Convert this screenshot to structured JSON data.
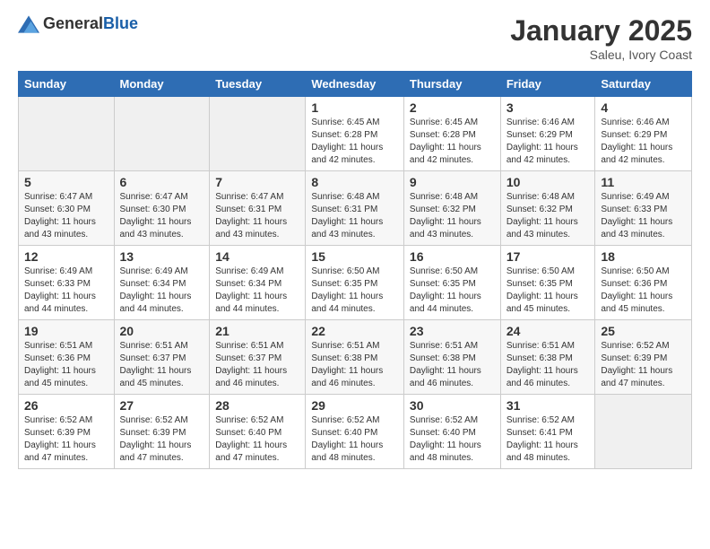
{
  "logo": {
    "general": "General",
    "blue": "Blue"
  },
  "title": {
    "month": "January 2025",
    "location": "Saleu, Ivory Coast"
  },
  "headers": [
    "Sunday",
    "Monday",
    "Tuesday",
    "Wednesday",
    "Thursday",
    "Friday",
    "Saturday"
  ],
  "weeks": [
    [
      {
        "day": "",
        "info": "",
        "empty": true
      },
      {
        "day": "",
        "info": "",
        "empty": true
      },
      {
        "day": "",
        "info": "",
        "empty": true
      },
      {
        "day": "1",
        "info": "Sunrise: 6:45 AM\nSunset: 6:28 PM\nDaylight: 11 hours\nand 42 minutes.",
        "empty": false
      },
      {
        "day": "2",
        "info": "Sunrise: 6:45 AM\nSunset: 6:28 PM\nDaylight: 11 hours\nand 42 minutes.",
        "empty": false
      },
      {
        "day": "3",
        "info": "Sunrise: 6:46 AM\nSunset: 6:29 PM\nDaylight: 11 hours\nand 42 minutes.",
        "empty": false
      },
      {
        "day": "4",
        "info": "Sunrise: 6:46 AM\nSunset: 6:29 PM\nDaylight: 11 hours\nand 42 minutes.",
        "empty": false
      }
    ],
    [
      {
        "day": "5",
        "info": "Sunrise: 6:47 AM\nSunset: 6:30 PM\nDaylight: 11 hours\nand 43 minutes.",
        "empty": false
      },
      {
        "day": "6",
        "info": "Sunrise: 6:47 AM\nSunset: 6:30 PM\nDaylight: 11 hours\nand 43 minutes.",
        "empty": false
      },
      {
        "day": "7",
        "info": "Sunrise: 6:47 AM\nSunset: 6:31 PM\nDaylight: 11 hours\nand 43 minutes.",
        "empty": false
      },
      {
        "day": "8",
        "info": "Sunrise: 6:48 AM\nSunset: 6:31 PM\nDaylight: 11 hours\nand 43 minutes.",
        "empty": false
      },
      {
        "day": "9",
        "info": "Sunrise: 6:48 AM\nSunset: 6:32 PM\nDaylight: 11 hours\nand 43 minutes.",
        "empty": false
      },
      {
        "day": "10",
        "info": "Sunrise: 6:48 AM\nSunset: 6:32 PM\nDaylight: 11 hours\nand 43 minutes.",
        "empty": false
      },
      {
        "day": "11",
        "info": "Sunrise: 6:49 AM\nSunset: 6:33 PM\nDaylight: 11 hours\nand 43 minutes.",
        "empty": false
      }
    ],
    [
      {
        "day": "12",
        "info": "Sunrise: 6:49 AM\nSunset: 6:33 PM\nDaylight: 11 hours\nand 44 minutes.",
        "empty": false
      },
      {
        "day": "13",
        "info": "Sunrise: 6:49 AM\nSunset: 6:34 PM\nDaylight: 11 hours\nand 44 minutes.",
        "empty": false
      },
      {
        "day": "14",
        "info": "Sunrise: 6:49 AM\nSunset: 6:34 PM\nDaylight: 11 hours\nand 44 minutes.",
        "empty": false
      },
      {
        "day": "15",
        "info": "Sunrise: 6:50 AM\nSunset: 6:35 PM\nDaylight: 11 hours\nand 44 minutes.",
        "empty": false
      },
      {
        "day": "16",
        "info": "Sunrise: 6:50 AM\nSunset: 6:35 PM\nDaylight: 11 hours\nand 44 minutes.",
        "empty": false
      },
      {
        "day": "17",
        "info": "Sunrise: 6:50 AM\nSunset: 6:35 PM\nDaylight: 11 hours\nand 45 minutes.",
        "empty": false
      },
      {
        "day": "18",
        "info": "Sunrise: 6:50 AM\nSunset: 6:36 PM\nDaylight: 11 hours\nand 45 minutes.",
        "empty": false
      }
    ],
    [
      {
        "day": "19",
        "info": "Sunrise: 6:51 AM\nSunset: 6:36 PM\nDaylight: 11 hours\nand 45 minutes.",
        "empty": false
      },
      {
        "day": "20",
        "info": "Sunrise: 6:51 AM\nSunset: 6:37 PM\nDaylight: 11 hours\nand 45 minutes.",
        "empty": false
      },
      {
        "day": "21",
        "info": "Sunrise: 6:51 AM\nSunset: 6:37 PM\nDaylight: 11 hours\nand 46 minutes.",
        "empty": false
      },
      {
        "day": "22",
        "info": "Sunrise: 6:51 AM\nSunset: 6:38 PM\nDaylight: 11 hours\nand 46 minutes.",
        "empty": false
      },
      {
        "day": "23",
        "info": "Sunrise: 6:51 AM\nSunset: 6:38 PM\nDaylight: 11 hours\nand 46 minutes.",
        "empty": false
      },
      {
        "day": "24",
        "info": "Sunrise: 6:51 AM\nSunset: 6:38 PM\nDaylight: 11 hours\nand 46 minutes.",
        "empty": false
      },
      {
        "day": "25",
        "info": "Sunrise: 6:52 AM\nSunset: 6:39 PM\nDaylight: 11 hours\nand 47 minutes.",
        "empty": false
      }
    ],
    [
      {
        "day": "26",
        "info": "Sunrise: 6:52 AM\nSunset: 6:39 PM\nDaylight: 11 hours\nand 47 minutes.",
        "empty": false
      },
      {
        "day": "27",
        "info": "Sunrise: 6:52 AM\nSunset: 6:39 PM\nDaylight: 11 hours\nand 47 minutes.",
        "empty": false
      },
      {
        "day": "28",
        "info": "Sunrise: 6:52 AM\nSunset: 6:40 PM\nDaylight: 11 hours\nand 47 minutes.",
        "empty": false
      },
      {
        "day": "29",
        "info": "Sunrise: 6:52 AM\nSunset: 6:40 PM\nDaylight: 11 hours\nand 48 minutes.",
        "empty": false
      },
      {
        "day": "30",
        "info": "Sunrise: 6:52 AM\nSunset: 6:40 PM\nDaylight: 11 hours\nand 48 minutes.",
        "empty": false
      },
      {
        "day": "31",
        "info": "Sunrise: 6:52 AM\nSunset: 6:41 PM\nDaylight: 11 hours\nand 48 minutes.",
        "empty": false
      },
      {
        "day": "",
        "info": "",
        "empty": true
      }
    ]
  ]
}
